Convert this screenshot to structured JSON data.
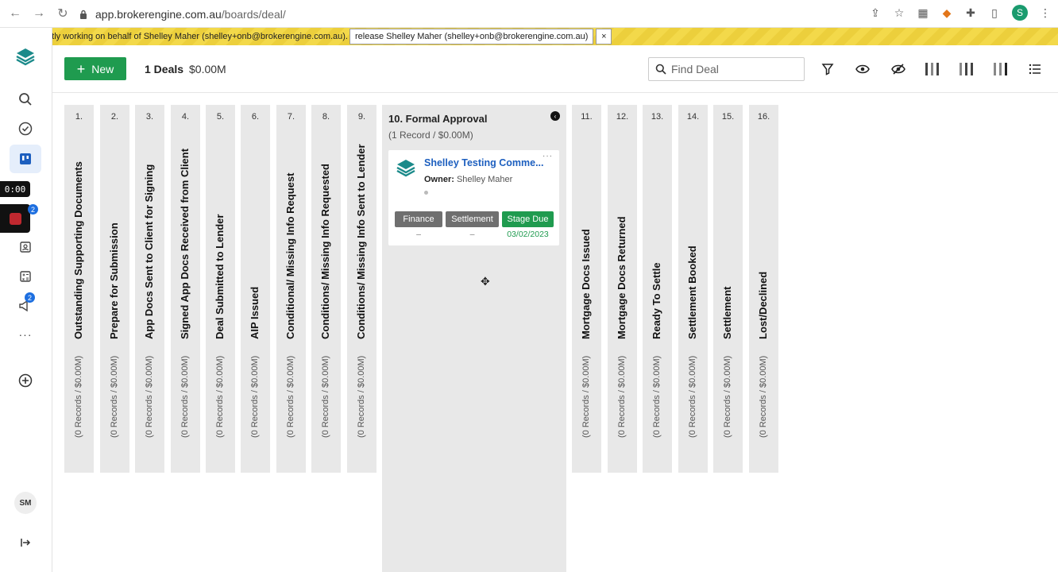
{
  "browser": {
    "url_host": "app.brokerengine.com.au",
    "url_path": "/boards/deal/",
    "profile_initial": "S"
  },
  "banner": {
    "text": "ntly working on behalf of Shelley Maher (shelley+onb@brokerengine.com.au).",
    "release_label": "release Shelley Maher (shelley+onb@brokerengine.com.au)",
    "close_label": "×"
  },
  "sidebar": {
    "timer": "0:00",
    "badges": {
      "recording": "2",
      "announcements": "2"
    },
    "avatar_initials": "SM"
  },
  "toolbar": {
    "new_label": "New",
    "deal_count": "1 Deals",
    "deal_total": "$0.00M",
    "search_placeholder": "Find Deal"
  },
  "columns": [
    {
      "num": "1.",
      "title": "Outstanding Supporting Documents",
      "count": "(0 Records / $0.00M)"
    },
    {
      "num": "2.",
      "title": "Prepare for Submission",
      "count": "(0 Records / $0.00M)"
    },
    {
      "num": "3.",
      "title": "App Docs Sent to Client for Signing",
      "count": "(0 Records / $0.00M)"
    },
    {
      "num": "4.",
      "title": "Signed App Docs Received from Client",
      "count": "(0 Records / $0.00M)"
    },
    {
      "num": "5.",
      "title": "Deal Submitted to Lender",
      "count": "(0 Records / $0.00M)"
    },
    {
      "num": "6.",
      "title": "AIP Issued",
      "count": "(0 Records / $0.00M)"
    },
    {
      "num": "7.",
      "title": "Conditional/ Missing Info Request",
      "count": "(0 Records / $0.00M)"
    },
    {
      "num": "8.",
      "title": "Conditions/ Missing Info Requested",
      "count": "(0 Records / $0.00M)"
    },
    {
      "num": "9.",
      "title": "Conditions/ Missing Info Sent to Lender",
      "count": "(0 Records / $0.00M)"
    },
    {
      "num": "11.",
      "title": "Mortgage Docs Issued",
      "count": "(0 Records / $0.00M)"
    },
    {
      "num": "12.",
      "title": "Mortgage Docs Returned",
      "count": "(0 Records / $0.00M)"
    },
    {
      "num": "13.",
      "title": "Ready To Settle",
      "count": "(0 Records / $0.00M)"
    },
    {
      "num": "14.",
      "title": "Settlement Booked",
      "count": "(0 Records / $0.00M)"
    },
    {
      "num": "15.",
      "title": "Settlement",
      "count": "(0 Records / $0.00M)"
    },
    {
      "num": "16.",
      "title": "Lost/Declined",
      "count": "(0 Records / $0.00M)"
    }
  ],
  "open_column": {
    "title": "10. Formal Approval",
    "subtitle": "(1 Record / $0.00M)",
    "card": {
      "title": "Shelley Testing Comme...",
      "owner_label": "Owner:",
      "owner_name": "Shelley Maher",
      "more": "···",
      "tags": [
        {
          "label": "Finance",
          "value": "–",
          "color": "#6f6f6f"
        },
        {
          "label": "Settlement",
          "value": "–",
          "color": "#6f6f6f"
        },
        {
          "label": "Stage Due",
          "value": "03/02/2023",
          "color": "#1f9b4f"
        }
      ]
    }
  },
  "colors": {
    "accent": "#1f9b4f",
    "link": "#1d5fbf",
    "banner": "#f3d94a"
  }
}
